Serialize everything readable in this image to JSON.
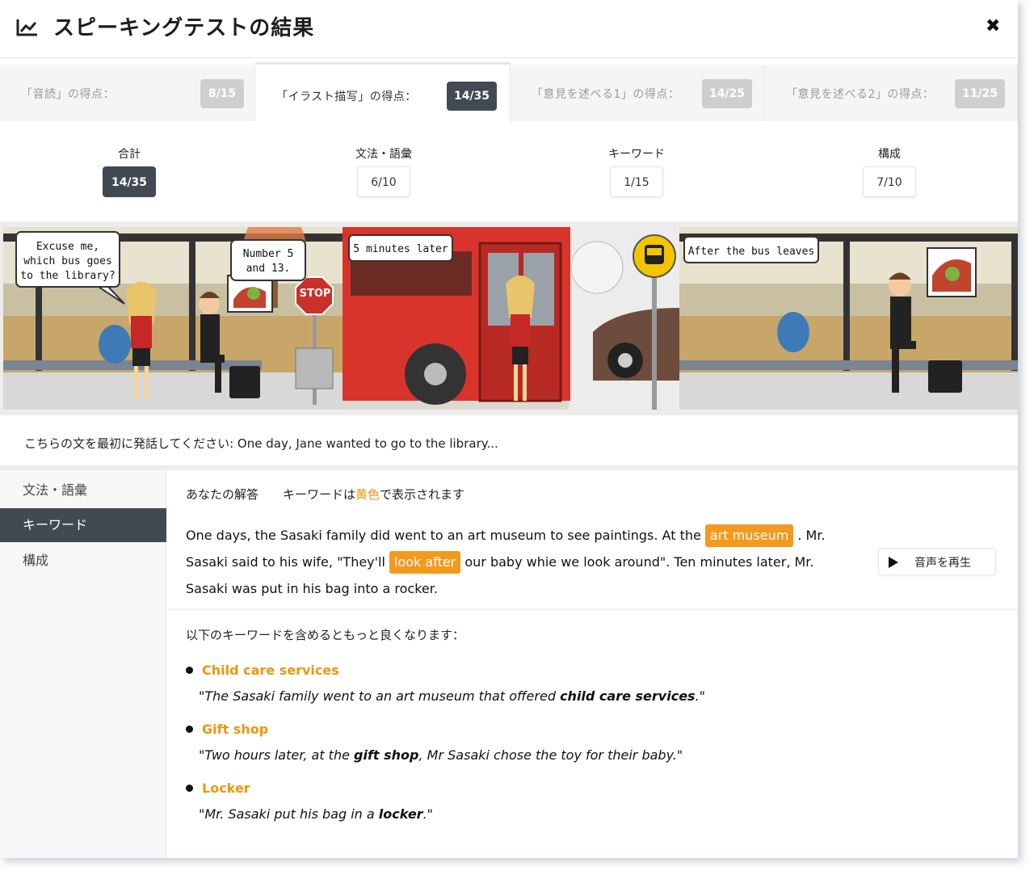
{
  "header": {
    "title": "スピーキングテストの結果",
    "close_icon": "close-icon",
    "chart_icon": "chart-line-icon"
  },
  "tabs": [
    {
      "label": "「音読」の得点：",
      "score": "8/15",
      "active": false
    },
    {
      "label": "「イラスト描写」の得点：",
      "score": "14/35",
      "active": true
    },
    {
      "label": "「意見を述べる1」の得点：",
      "score": "14/25",
      "active": false
    },
    {
      "label": "「意見を述べる2」の得点：",
      "score": "11/25",
      "active": false
    }
  ],
  "summary": [
    {
      "label": "合計",
      "score": "14/35"
    },
    {
      "label": "文法・語彙",
      "score": "6/10"
    },
    {
      "label": "キーワード",
      "score": "1/15"
    },
    {
      "label": "構成",
      "score": "7/10"
    }
  ],
  "comic": {
    "bubble1": [
      "Excuse me,",
      "which bus goes",
      "to the library?"
    ],
    "bubble2": [
      "Number 5",
      "and 13."
    ],
    "stop_sign": "STOP",
    "caption2": "5 minutes later",
    "caption3": "After the bus leaves"
  },
  "prompt": "こちらの文を最初に発話してください: One day, Jane wanted to go to the library...",
  "sidebar": [
    "文法・語彙",
    "キーワード",
    "構成"
  ],
  "answer": {
    "head": "あなたの解答",
    "kw_note_pre": "キーワードは",
    "kw_note_color": "黄色",
    "kw_note_post": "で表示されます",
    "text1": "One days, the Sasaki family did went to an art museum to see paintings. At the ",
    "hl1": "art museum",
    "text2": " . Mr. Sasaki said to his wife, \"They'll ",
    "hl2": "look after",
    "text3": " our baby whie we look around\". Ten minutes later, Mr. Sasaki was put in his bag into a rocker.",
    "play_label": "音声を再生"
  },
  "tip": "以下のキーワードを含めるともっと良くなります：",
  "keywords": [
    {
      "name": "Child care services",
      "pre": "\"The Sasaki family went to an art museum that offered ",
      "bold": "child care services",
      "post": ".\""
    },
    {
      "name": "Gift shop",
      "pre": "\"Two hours later, at the ",
      "bold": "gift shop",
      "post": ", Mr Sasaki chose the toy for their baby.\""
    },
    {
      "name": "Locker",
      "pre": "\"Mr. Sasaki put his bag in a ",
      "bold": "locker",
      "post": ".\""
    }
  ],
  "colors": {
    "dark": "#414a52",
    "accent": "#f39a1e",
    "bus_red": "#d9342b"
  }
}
